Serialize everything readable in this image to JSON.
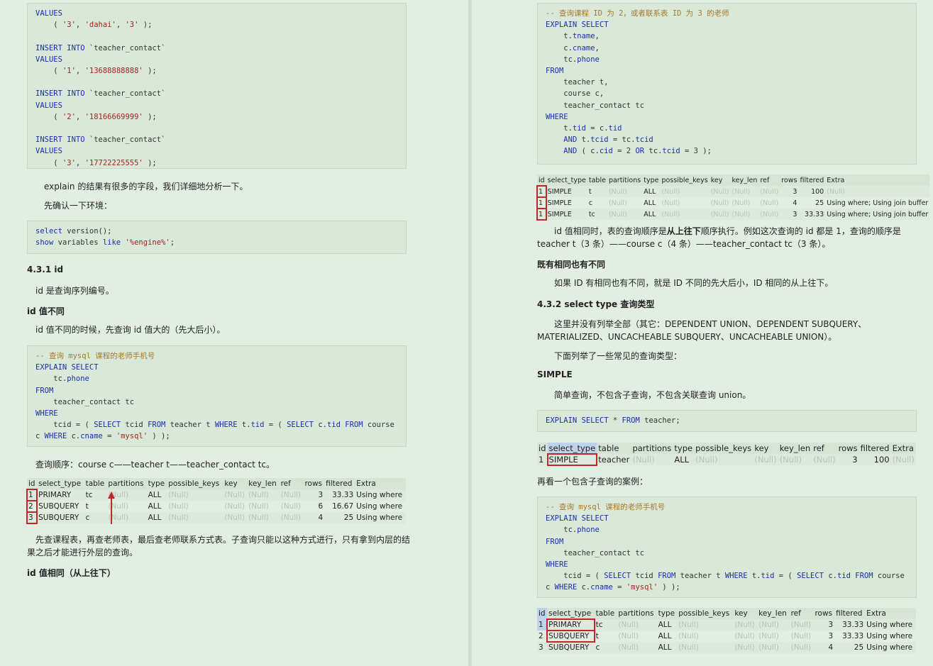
{
  "left": {
    "code1": [
      "VALUES",
      "    ( '3', 'dahai', '3' );",
      "",
      "INSERT INTO `teacher_contact`",
      "VALUES",
      "    ( '1', '13688888888' );",
      "",
      "INSERT INTO `teacher_contact`",
      "VALUES",
      "    ( '2', '18166669999' );",
      "",
      "INSERT INTO `teacher_contact`",
      "VALUES",
      "    ( '3', '17722225555' );"
    ],
    "p1": "explain 的结果有很多的字段，我们详细地分析一下。",
    "p2": "先确认一下环境：",
    "code2": [
      "select version();",
      "show variables like '%engine%';"
    ],
    "h_431": "4.3.1 id",
    "p3": "id 是查询序列编号。",
    "h_diff": "id 值不同",
    "p4": "id 值不同的时候，先查询 id 值大的（先大后小）。",
    "code3": [
      "-- 查询 mysql 课程的老师手机号",
      "EXPLAIN SELECT",
      "    tc.phone",
      "FROM",
      "    teacher_contact tc",
      "WHERE",
      "    tcid = ( SELECT tcid FROM teacher t WHERE t.tid = ( SELECT c.tid FROM course",
      "c WHERE c.cname = 'mysql' ) );"
    ],
    "p5": "查询顺序：course c——teacher t——teacher_contact tc。",
    "table1": {
      "headers": [
        "id",
        "select_type",
        "table",
        "partitions",
        "type",
        "possible_keys",
        "key",
        "key_len",
        "ref",
        "rows",
        "filtered",
        "Extra"
      ],
      "rows": [
        [
          "1",
          "PRIMARY",
          "tc",
          "(Null)",
          "ALL",
          "(Null)",
          "(Null)",
          "(Null)",
          "(Null)",
          "3",
          "33.33",
          "Using where"
        ],
        [
          "2",
          "SUBQUERY",
          "t",
          "(Null)",
          "ALL",
          "(Null)",
          "(Null)",
          "(Null)",
          "(Null)",
          "6",
          "16.67",
          "Using where"
        ],
        [
          "3",
          "SUBQUERY",
          "c",
          "(Null)",
          "ALL",
          "(Null)",
          "(Null)",
          "(Null)",
          "(Null)",
          "4",
          "25",
          "Using where"
        ]
      ]
    },
    "p6": "先查课程表，再查老师表，最后查老师联系方式表。子查询只能以这种方式进行，只有拿到内层的结果之后才能进行外层的查询。",
    "h_same": "id 值相同（从上往下）"
  },
  "right": {
    "code1": [
      "-- 查询课程 ID 为 2，或者联系表 ID 为 3 的老师",
      "EXPLAIN SELECT",
      "    t.tname,",
      "    c.cname,",
      "    tc.phone",
      "FROM",
      "    teacher t,",
      "    course c,",
      "    teacher_contact tc",
      "WHERE",
      "    t.tid = c.tid",
      "    AND t.tcid = tc.tcid",
      "    AND ( c.cid = 2 OR tc.tcid = 3 );"
    ],
    "table1": {
      "headers": [
        "id",
        "select_type",
        "table",
        "partitions",
        "type",
        "possible_keys",
        "key",
        "key_len",
        "ref",
        "rows",
        "filtered",
        "Extra"
      ],
      "rows": [
        [
          "1",
          "SIMPLE",
          "t",
          "(Null)",
          "ALL",
          "(Null)",
          "(Null)",
          "(Null)",
          "(Null)",
          "3",
          "100",
          "(Null)"
        ],
        [
          "1",
          "SIMPLE",
          "c",
          "(Null)",
          "ALL",
          "(Null)",
          "(Null)",
          "(Null)",
          "(Null)",
          "4",
          "25",
          "Using where; Using join buffer"
        ],
        [
          "1",
          "SIMPLE",
          "tc",
          "(Null)",
          "ALL",
          "(Null)",
          "(Null)",
          "(Null)",
          "(Null)",
          "3",
          "33.33",
          "Using where; Using join buffer"
        ]
      ]
    },
    "p1a": "id 值相同时，表的查询顺序是",
    "p1b": "从上往下",
    "p1c": "顺序执行。例如这次查询的 id 都是 1，查询的顺序是 teacher t（3 条）——course c（4 条）——teacher_contact tc（3 条）。",
    "h_mixed": "既有相同也有不同",
    "p2": "如果 ID 有相同也有不同，就是 ID 不同的先大后小，ID 相同的从上往下。",
    "h_432": "4.3.2 select type 查询类型",
    "p3": "这里并没有列举全部（其它：DEPENDENT UNION、DEPENDENT SUBQUERY、MATERIALIZED、UNCACHEABLE SUBQUERY、UNCACHEABLE UNION）。",
    "p4": "下面列举了一些常见的查询类型：",
    "h_simple": "SIMPLE",
    "p5": "简单查询，不包含子查询，不包含关联查询 union。",
    "code2": [
      "EXPLAIN SELECT * FROM teacher;"
    ],
    "table2": {
      "headers": [
        "id",
        "select_type",
        "table",
        "partitions",
        "type",
        "possible_keys",
        "key",
        "key_len",
        "ref",
        "rows",
        "filtered",
        "Extra"
      ],
      "rows": [
        [
          "1",
          "SIMPLE",
          "teacher",
          "(Null)",
          "ALL",
          "(Null)",
          "(Null)",
          "(Null)",
          "(Null)",
          "3",
          "100",
          "(Null)"
        ]
      ]
    },
    "p6": "再看一个包含子查询的案例：",
    "code3": [
      "-- 查询 mysql 课程的老师手机号",
      "EXPLAIN SELECT",
      "    tc.phone",
      "FROM",
      "    teacher_contact tc",
      "WHERE",
      "    tcid = ( SELECT tcid FROM teacher t WHERE t.tid = ( SELECT c.tid FROM course",
      "c WHERE c.cname = 'mysql' ) );"
    ],
    "table3": {
      "headers": [
        "id",
        "select_type",
        "table",
        "partitions",
        "type",
        "possible_keys",
        "key",
        "key_len",
        "ref",
        "rows",
        "filtered",
        "Extra"
      ],
      "rows": [
        [
          "1",
          "PRIMARY",
          "tc",
          "(Null)",
          "ALL",
          "(Null)",
          "(Null)",
          "(Null)",
          "(Null)",
          "3",
          "33.33",
          "Using where"
        ],
        [
          "2",
          "SUBQUERY",
          "t",
          "(Null)",
          "ALL",
          "(Null)",
          "(Null)",
          "(Null)",
          "(Null)",
          "3",
          "33.33",
          "Using where"
        ],
        [
          "3",
          "SUBQUERY",
          "c",
          "(Null)",
          "ALL",
          "(Null)",
          "(Null)",
          "(Null)",
          "(Null)",
          "4",
          "25",
          "Using where"
        ]
      ]
    }
  }
}
